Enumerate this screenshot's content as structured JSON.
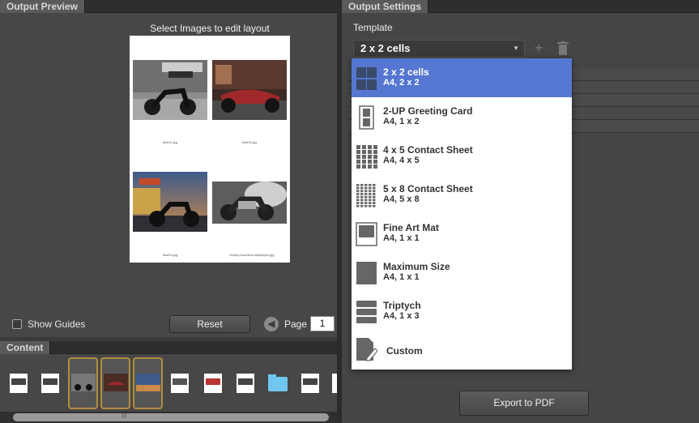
{
  "preview": {
    "tab": "Output Preview",
    "instruction": "Select Images to edit layout",
    "captions": [
      "bike01.jpg",
      "bike05.jpg",
      "bike09.jpg",
      "Harley-Davidson-Wallpaper.jpg"
    ],
    "show_guides": "Show Guides",
    "reset": "Reset",
    "page_label": "Page",
    "page_value": "1"
  },
  "content": {
    "tab": "Content",
    "scroll_grip": "III"
  },
  "settings": {
    "tab": "Output Settings",
    "template_label": "Template",
    "selected_template": "2 x 2 cells",
    "add_symbol": "+",
    "export": "Export to PDF",
    "options": [
      {
        "name": "2 x 2 cells",
        "sub": "A4, 2 x 2",
        "icon": "grid-2x2-icon"
      },
      {
        "name": "2-UP Greeting Card",
        "sub": "A4, 1 x 2",
        "icon": "greeting-card-icon"
      },
      {
        "name": "4 x 5 Contact Sheet",
        "sub": "A4, 4 x 5",
        "icon": "grid-4x5-icon"
      },
      {
        "name": "5 x 8 Contact Sheet",
        "sub": "A4, 5 x 8",
        "icon": "grid-5x8-icon"
      },
      {
        "name": "Fine Art Mat",
        "sub": "A4, 1 x 1",
        "icon": "fine-art-mat-icon"
      },
      {
        "name": "Maximum Size",
        "sub": "A4, 1 x 1",
        "icon": "maximum-size-icon"
      },
      {
        "name": "Triptych",
        "sub": "A4, 1 x 3",
        "icon": "triptych-icon"
      },
      {
        "name": "Custom",
        "sub": "",
        "icon": "custom-edit-icon"
      }
    ]
  },
  "colors": {
    "selection": "#5577d1",
    "thumb_border": "#b28f3c",
    "icon_gray": "#666666"
  }
}
